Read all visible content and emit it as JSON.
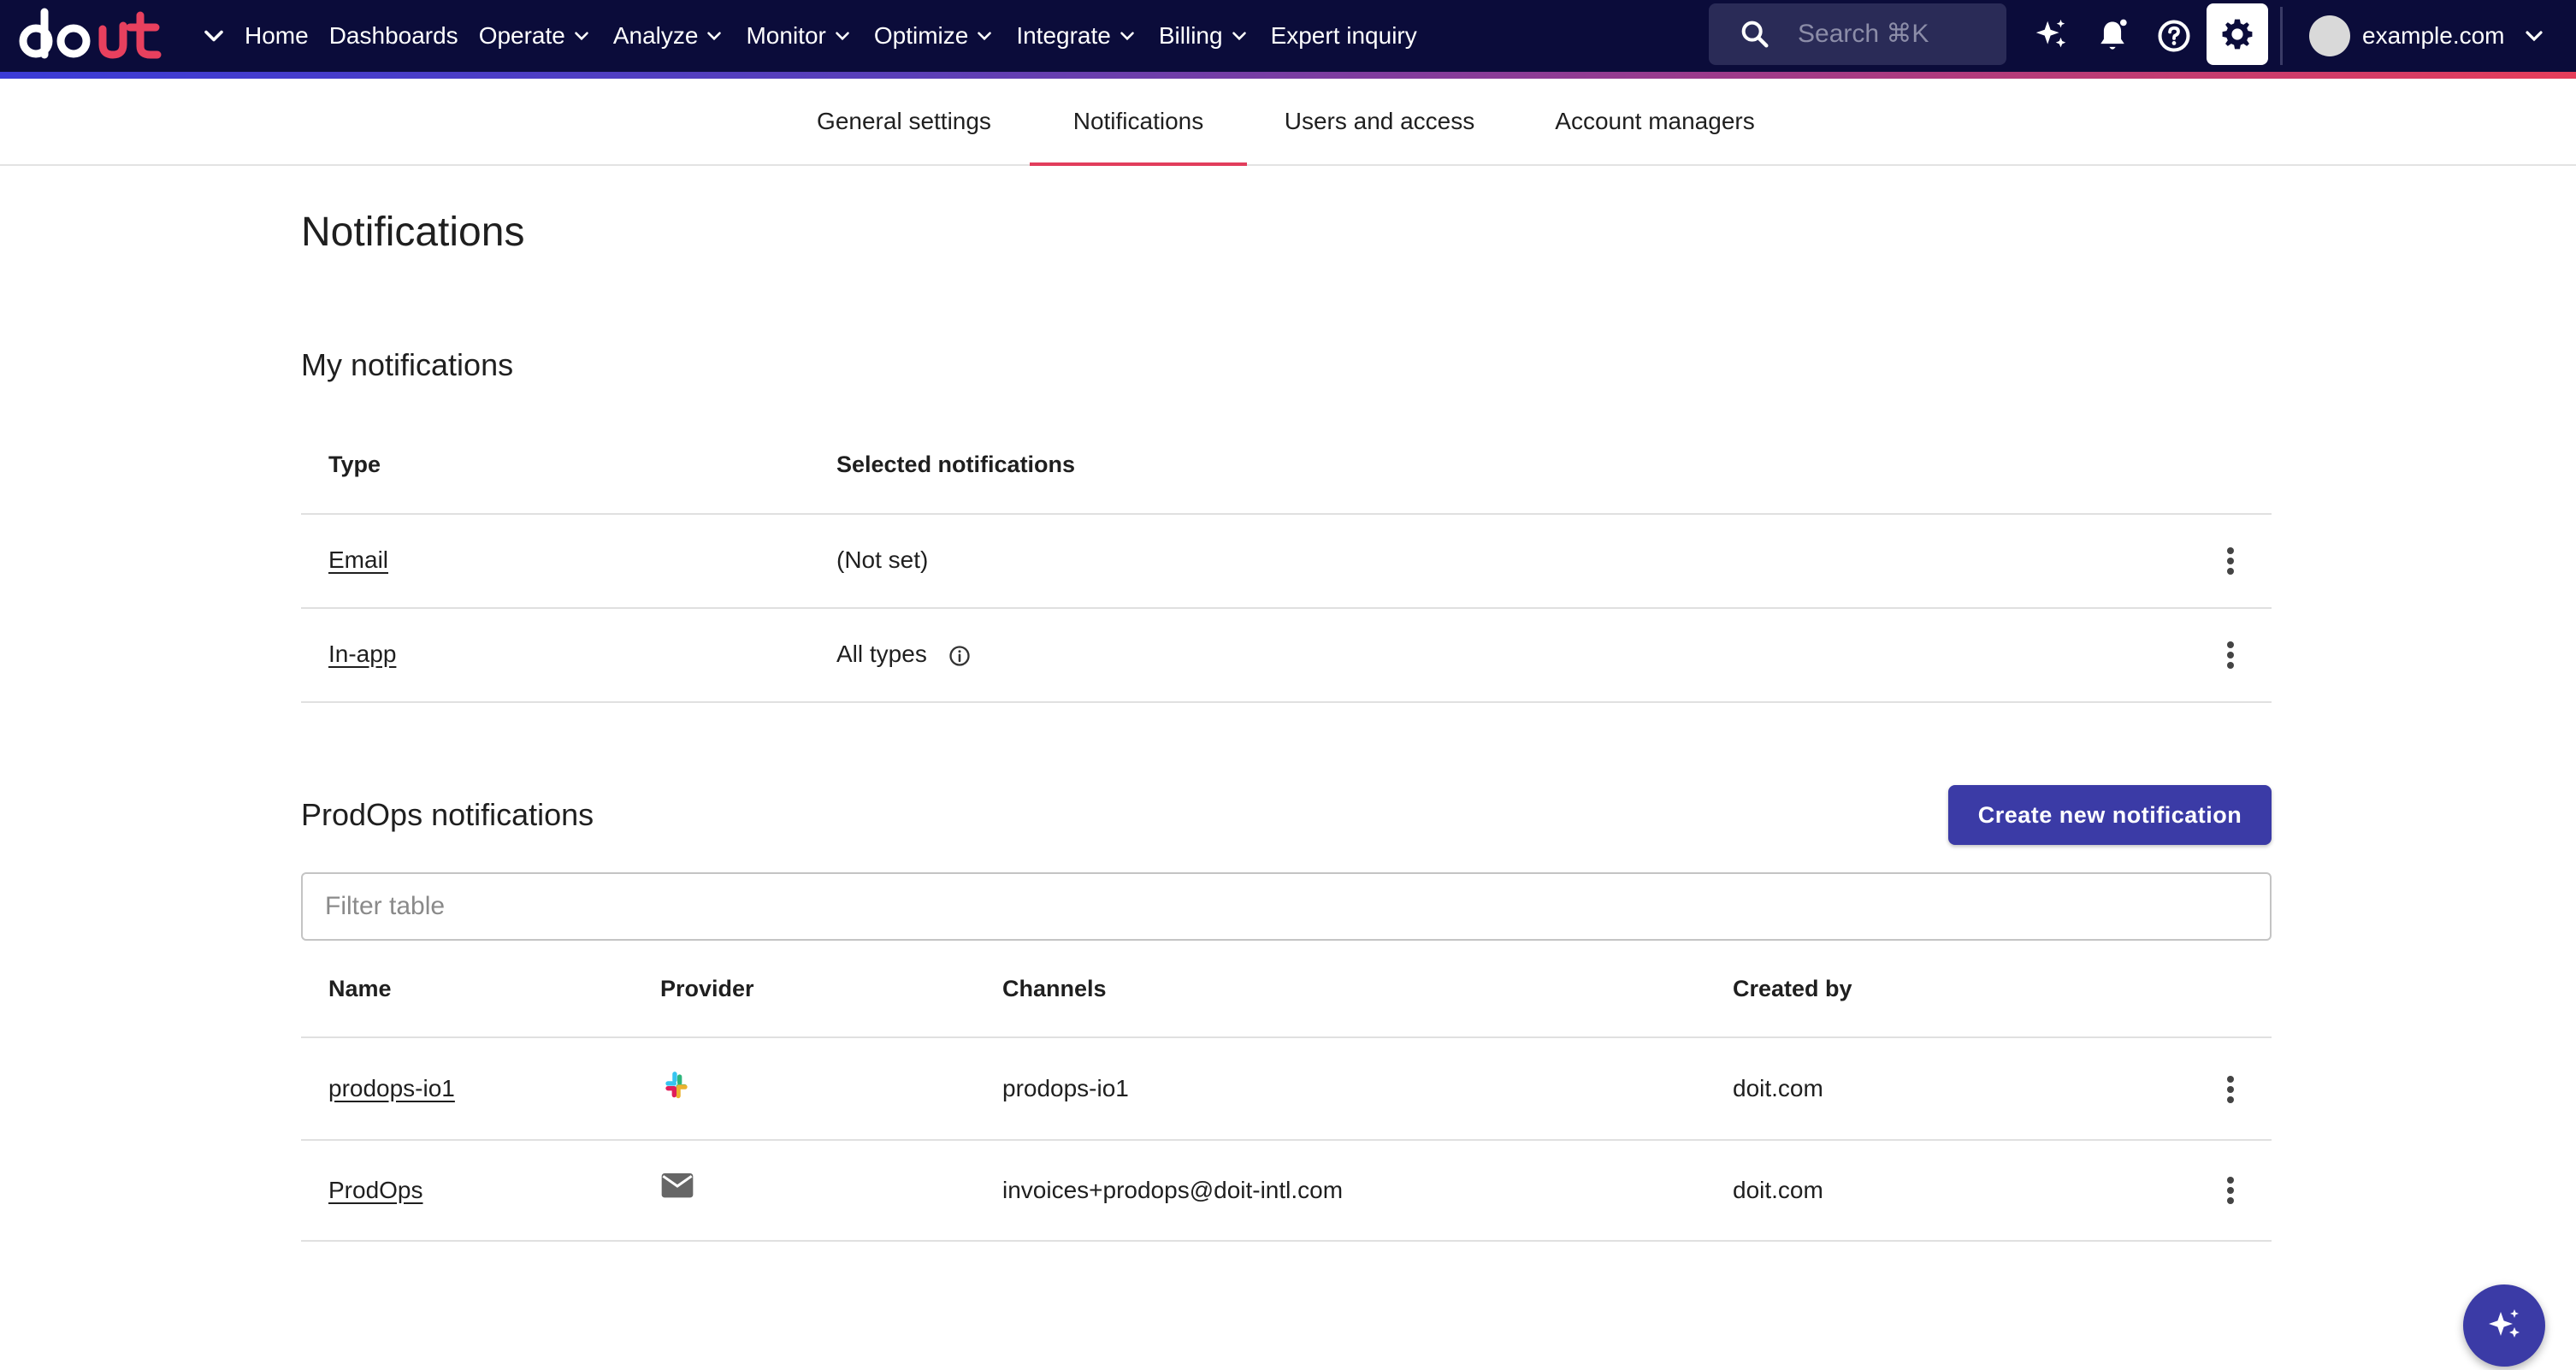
{
  "brand": {
    "logo_text": "doit",
    "accent_color": "#3b3ba6",
    "nav_bg": "#0b0c3a",
    "tab_indicator": "#e23d5c"
  },
  "nav": {
    "items": [
      {
        "label": "Home",
        "dropdown": false
      },
      {
        "label": "Dashboards",
        "dropdown": false
      },
      {
        "label": "Operate",
        "dropdown": true
      },
      {
        "label": "Analyze",
        "dropdown": true
      },
      {
        "label": "Monitor",
        "dropdown": true
      },
      {
        "label": "Optimize",
        "dropdown": true
      },
      {
        "label": "Integrate",
        "dropdown": true
      },
      {
        "label": "Billing",
        "dropdown": true
      },
      {
        "label": "Expert inquiry",
        "dropdown": false
      }
    ],
    "search_placeholder": "Search ⌘K",
    "icons": [
      "sparkle-icon",
      "bell-icon",
      "help-icon",
      "gear-icon"
    ],
    "account": "example.com"
  },
  "tabs": {
    "general": "General settings",
    "notifications": "Notifications",
    "users": "Users and access",
    "managers": "Account managers",
    "active": "Notifications"
  },
  "page": {
    "title": "Notifications"
  },
  "my_notifications": {
    "title": "My notifications",
    "headers": {
      "type": "Type",
      "selected": "Selected notifications"
    },
    "rows": [
      {
        "type": "Email",
        "selected": "(Not set)",
        "info": false
      },
      {
        "type": "In-app",
        "selected": "All types",
        "info": true
      }
    ]
  },
  "prodops": {
    "title": "ProdOps notifications",
    "create_button": "Create new notification",
    "filter_placeholder": "Filter table",
    "headers": {
      "name": "Name",
      "provider": "Provider",
      "channels": "Channels",
      "created_by": "Created by"
    },
    "rows": [
      {
        "name": "prodops-io1",
        "provider": "slack-icon",
        "channels": "prodops-io1",
        "created_by": "doit.com"
      },
      {
        "name": "ProdOps",
        "provider": "email-icon",
        "channels": "invoices+prodops@doit-intl.com",
        "created_by": "doit.com"
      }
    ]
  },
  "fab": {
    "icon": "sparkle-icon"
  }
}
